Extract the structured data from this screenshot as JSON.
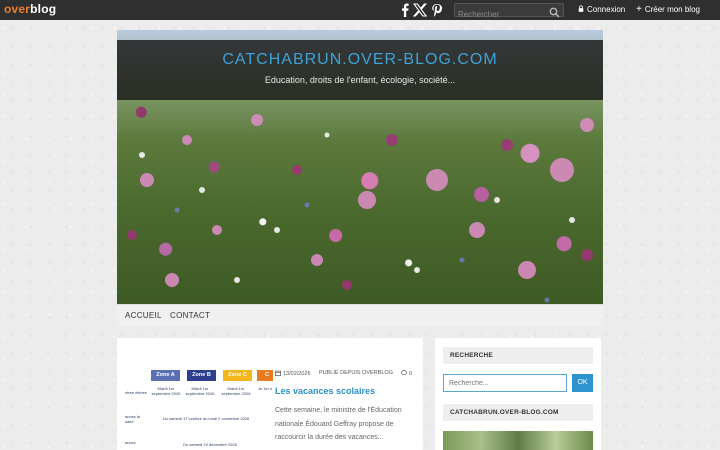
{
  "topbar": {
    "logo_a": "over",
    "logo_b": "blog",
    "social": [
      "facebook-icon",
      "x-icon",
      "pinterest-icon"
    ],
    "search_placeholder": "Rechercher",
    "login_label": "Connexion",
    "create_label": "Créer mon blog"
  },
  "header": {
    "title": "CATCHABRUN.OVER-BLOG.COM",
    "subtitle": "Education, droits de l'enfant, écologie, société..."
  },
  "nav": {
    "items": [
      "ACCUEIL",
      "CONTACT"
    ]
  },
  "article": {
    "date": "13/02/2026",
    "category": "PUBLIÉ DEPUIS OVERBLOG",
    "comments": "0",
    "title": "Les vacances scolaires",
    "excerpt": "Cette semaine, le ministre de l'Éducation nationale Édouard Geffray propose de raccourcir la durée des vacances...",
    "thumbnail": {
      "zones": [
        "Zone A",
        "Zone B",
        "Zone C",
        "C"
      ],
      "zone_colors": [
        "#5b6fb5",
        "#2e3f8f",
        "#f3b71b",
        "#e97a1f"
      ],
      "row_labels": [
        "ntrée élèves",
        "ances la saint",
        "ances"
      ],
      "cells": [
        "Mardi 1er septembre 2026",
        "Mardi 1er septembre 2026",
        "Mardi 1er septembre 2026",
        "Je 1er s",
        "Du samedi 17 octobre au lundi 2 novembre 2026",
        "Du samedi 19 décembre 2026"
      ]
    }
  },
  "sidebar": {
    "search_title": "RECHERCHE",
    "search_placeholder": "Recherche...",
    "search_button": "OK",
    "blog_title": "CATCHABRUN.OVER-BLOG.COM"
  },
  "colors": {
    "accent": "#2b91c8",
    "title_blue": "#3ea2d9",
    "logo_orange": "#f07c24",
    "topbar": "#2f2f2f"
  }
}
